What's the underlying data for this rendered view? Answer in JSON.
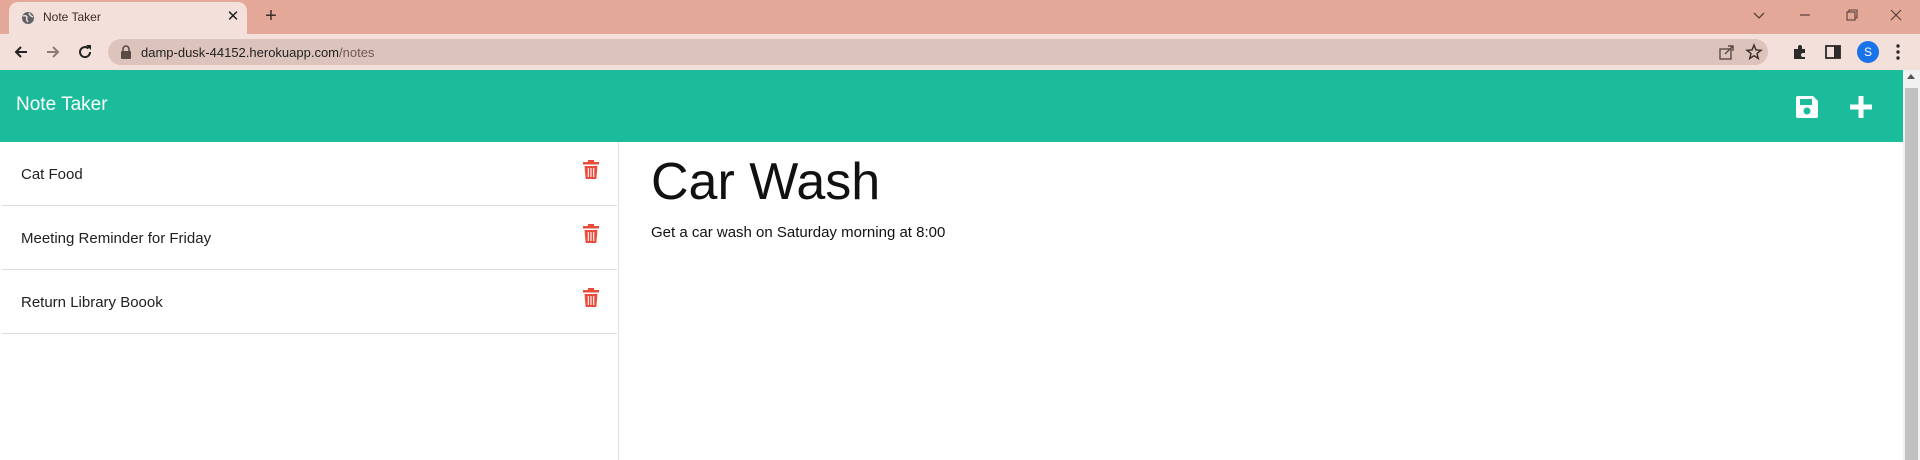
{
  "browser": {
    "tab_title": "Note Taker",
    "tab_close_glyph": "✕",
    "new_tab_glyph": "+",
    "url_host": "damp-dusk-44152.herokuapp.com",
    "url_path": "/notes",
    "profile_initial": "S",
    "window_controls": [
      "chevron-down-icon",
      "minimize-icon",
      "restore-icon",
      "close-icon"
    ]
  },
  "app": {
    "title": "Note Taker",
    "accent_color": "#1abc9c",
    "delete_color": "#e74c3c",
    "header_icons": [
      "save-icon",
      "plus-icon"
    ]
  },
  "notes": [
    {
      "title": "Cat Food"
    },
    {
      "title": "Meeting Reminder for Friday"
    },
    {
      "title": "Return Library Boook"
    }
  ],
  "active_note": {
    "title": "Car Wash",
    "text": "Get a car wash on Saturday morning at 8:00"
  }
}
